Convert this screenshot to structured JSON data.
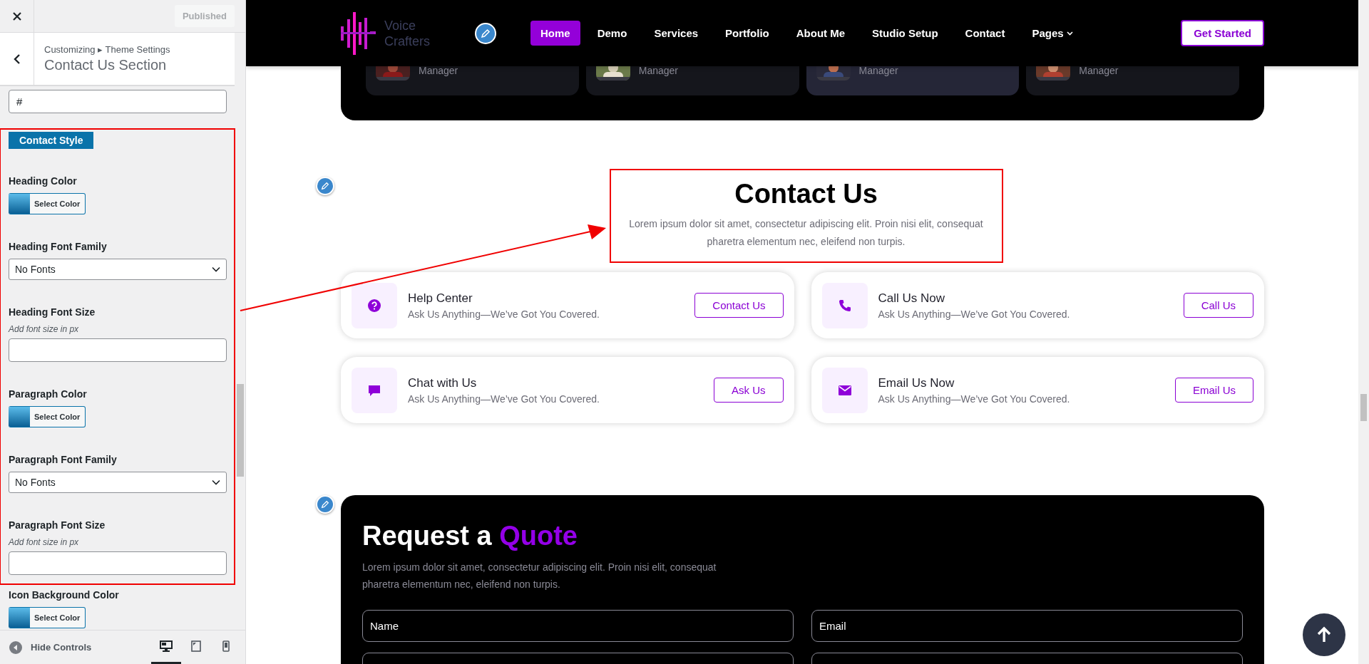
{
  "customizer": {
    "publish_button": "Published",
    "breadcrumb": "Customizing ▸ Theme Settings",
    "title": "Contact Us Section",
    "link_field": {
      "value": "#"
    },
    "framed_group": {
      "badge": "Contact Style",
      "controls": [
        {
          "kind": "color",
          "label": "Heading Color",
          "button": "Select Color"
        },
        {
          "kind": "select",
          "label": "Heading Font Family",
          "value": "No Fonts"
        },
        {
          "kind": "text",
          "label": "Heading Font Size",
          "hint": "Add font size in px"
        },
        {
          "kind": "color",
          "label": "Paragraph Color",
          "button": "Select Color"
        },
        {
          "kind": "select",
          "label": "Paragraph Font Family",
          "value": "No Fonts"
        },
        {
          "kind": "text",
          "label": "Paragraph Font Size",
          "hint": "Add font size in px"
        }
      ]
    },
    "controls": [
      {
        "kind": "color",
        "label": "Icon Background Color",
        "button": "Select Color"
      }
    ],
    "hide_controls": "Hide Controls",
    "devices": [
      {
        "kind": "desktop",
        "selected": true
      },
      {
        "kind": "tablet",
        "selected": false
      },
      {
        "kind": "mobile",
        "selected": false
      }
    ]
  },
  "site": {
    "logo": [
      "Voice",
      "Crafters"
    ],
    "nav": [
      {
        "label": "Home",
        "selected": true,
        "has_menu": false
      },
      {
        "label": "Demo",
        "selected": false,
        "has_menu": false
      },
      {
        "label": "Services",
        "selected": false,
        "has_menu": false
      },
      {
        "label": "Portfolio",
        "selected": false,
        "has_menu": false
      },
      {
        "label": "About Me",
        "selected": false,
        "has_menu": false
      },
      {
        "label": "Studio Setup",
        "selected": false,
        "has_menu": false
      },
      {
        "label": "Contact",
        "selected": false,
        "has_menu": false
      },
      {
        "label": "Pages",
        "selected": false,
        "has_menu": true
      }
    ],
    "cta": "Get Started",
    "team": [
      {
        "role": "Manager",
        "highlighted": false
      },
      {
        "role": "Manager",
        "highlighted": false
      },
      {
        "role": "Manager",
        "highlighted": true
      },
      {
        "role": "Manager",
        "highlighted": false
      }
    ],
    "contact": {
      "title": "Contact Us",
      "text": "Lorem ipsum dolor sit amet, consectetur adipiscing elit. Proin nisi elit, consequat pharetra elementum nec, eleifend non turpis.",
      "cards": [
        {
          "kind": "question",
          "title": "Help Center",
          "text": "Ask Us Anything—We’ve Got You Covered.",
          "button": "Contact Us"
        },
        {
          "kind": "phone",
          "title": "Call Us Now",
          "text": "Ask Us Anything—We’ve Got You Covered.",
          "button": "Call Us"
        },
        {
          "kind": "chat",
          "title": "Chat with Us",
          "text": "Ask Us Anything—We’ve Got You Covered.",
          "button": "Ask Us"
        },
        {
          "kind": "mail",
          "title": "Email Us Now",
          "text": "Ask Us Anything—We’ve Got You Covered.",
          "button": "Email Us"
        }
      ]
    },
    "quote": {
      "title": "Request a",
      "title_accent": "Quote",
      "text": "Lorem ipsum dolor sit amet, consectetur adipiscing elit. Proin nisi elit, consequat pharetra elementum nec, eleifend non turpis.",
      "fields": [
        {
          "placeholder": "Name"
        },
        {
          "placeholder": "Email"
        }
      ]
    }
  }
}
